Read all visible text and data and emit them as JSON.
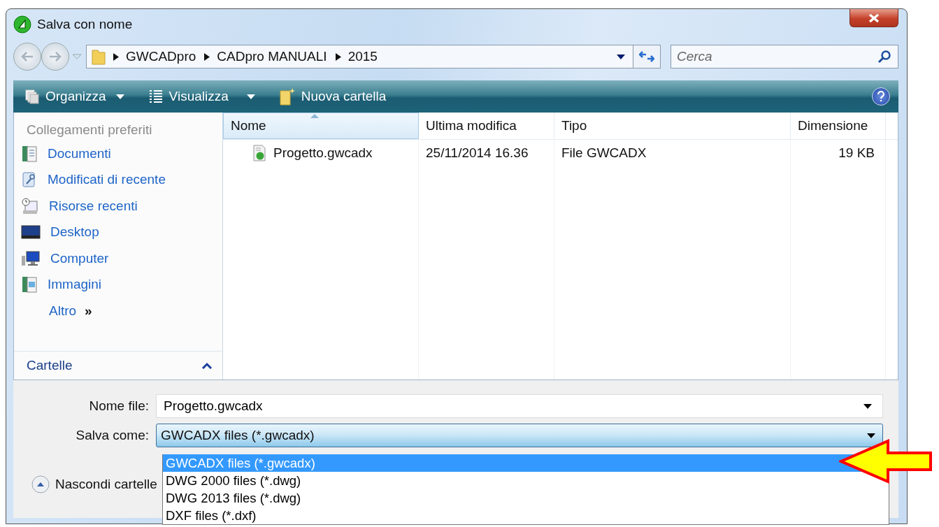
{
  "window": {
    "title": "Salva con nome"
  },
  "breadcrumb": [
    "GWCADpro",
    "CADpro MANUALI",
    "2015"
  ],
  "search": {
    "placeholder": "Cerca"
  },
  "toolbar": [
    {
      "label": "Organizza",
      "kind": "pages"
    },
    {
      "label": "Visualizza",
      "kind": "list"
    },
    {
      "label": "Nuova cartella",
      "kind": "folder"
    }
  ],
  "sidebar": {
    "heading": "Collegamenti preferiti",
    "items": [
      {
        "label": "Documenti",
        "kind": "documents"
      },
      {
        "label": "Modificati di recente",
        "kind": "recent"
      },
      {
        "label": "Risorse recenti",
        "kind": "clock"
      },
      {
        "label": "Desktop",
        "kind": "desktop"
      },
      {
        "label": "Computer",
        "kind": "computer"
      },
      {
        "label": "Immagini",
        "kind": "pictures"
      },
      {
        "label": "Altro",
        "kind": "more"
      }
    ],
    "more_glyph": "»",
    "folders": "Cartelle"
  },
  "table": {
    "columns": [
      {
        "label": "Nome",
        "sorted": true
      },
      {
        "label": "Ultima modifica",
        "sorted": false
      },
      {
        "label": "Tipo",
        "sorted": false
      },
      {
        "label": "Dimensione",
        "sorted": false
      }
    ],
    "rows": [
      {
        "name": "Progetto.gwcadx",
        "modified": "25/11/2014 16.36",
        "type": "File GWCADX",
        "size": "19 KB"
      }
    ]
  },
  "form": {
    "file_name_label": "Nome file:",
    "file_name": "Progetto.gwcadx",
    "save_as_label": "Salva come:",
    "save_as": "GWCADX files (*.gwcadx)",
    "options": [
      {
        "label": "GWCADX files (*.gwcadx)",
        "selected": true
      },
      {
        "label": "DWG 2000 files (*.dwg)",
        "selected": false
      },
      {
        "label": "DWG 2013 files (*.dwg)",
        "selected": false
      },
      {
        "label": "DXF files (*.dxf)",
        "selected": false
      }
    ]
  },
  "hide_folders": "Nascondi cartelle"
}
